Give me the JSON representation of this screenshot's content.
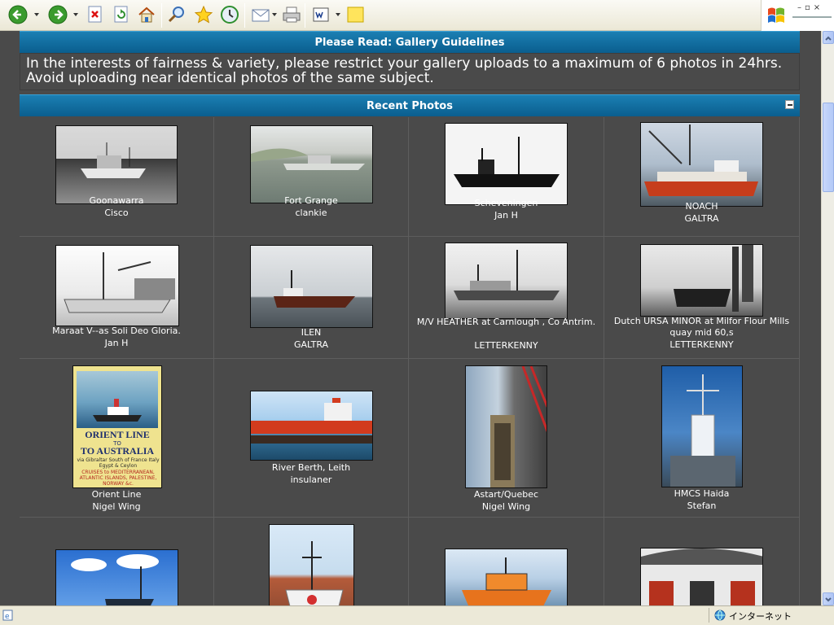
{
  "guidelines": {
    "title": "Please Read: Gallery Guidelines",
    "body": "In the interests of fairness & variety, please restrict your gallery uploads to a maximum of 6 photos in 24hrs. Avoid uploading near identical photos of the same subject."
  },
  "recent": {
    "title": "Recent Photos",
    "photos": [
      {
        "title": "Goonawarra",
        "user": "Cisco"
      },
      {
        "title": "Fort Grange",
        "user": "clankie"
      },
      {
        "title": "Scheveningen",
        "user": "Jan H"
      },
      {
        "title": "NOACH",
        "user": "GALTRA"
      },
      {
        "title": "Maraat V--as Soli Deo Gloria.",
        "user": "Jan H"
      },
      {
        "title": "ILEN",
        "user": "GALTRA"
      },
      {
        "title": "M/V HEATHER at Carnlough , Co Antrim.",
        "user": "LETTERKENNY"
      },
      {
        "title": "Dutch URSA MINOR at Milfor Flour Mills quay mid 60,s",
        "user": "LETTERKENNY"
      },
      {
        "title": "Orient Line",
        "user": "Nigel Wing"
      },
      {
        "title": "River Berth, Leith",
        "user": "insulaner"
      },
      {
        "title": "Astart/Quebec",
        "user": "Nigel Wing"
      },
      {
        "title": "HMCS Haida",
        "user": "Stefan"
      }
    ],
    "poster": {
      "line1": "ORIENT LINE",
      "line2": "TO AUSTRALIA",
      "line3": "via Gibraltar South of France Italy Egypt & Ceylon",
      "line4": "CRUISES to MEDITERRANEAN, ATLANTIC ISLANDS, PALESTINE, NORWAY &c."
    }
  },
  "status": {
    "zone": "インターネット"
  }
}
